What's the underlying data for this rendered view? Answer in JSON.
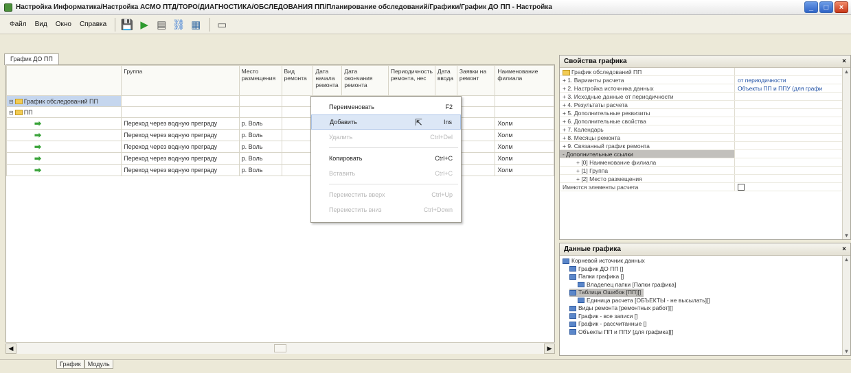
{
  "window": {
    "title": "Настройка Информатика/Настройка АСМО ПТД/ТОРО/ДИАГНОСТИКА/ОБСЛЕДОВАНИЯ ПП/Планирование обследований/Графики/График ДО ПП - Настройка"
  },
  "menu": [
    "Файл",
    "Вид",
    "Окно",
    "Справка"
  ],
  "toolbar_icons": [
    "save-icon",
    "run-icon",
    "properties-icon",
    "connections-icon",
    "table-icon",
    "window-icon"
  ],
  "doc_tab": "График ДО ПП",
  "grid": {
    "columns": [
      "",
      "Группа",
      "Место размещения",
      "Вид ремонта",
      "Дата начала ремонта",
      "Дата окончания ремонта",
      "Периодичность ремонта, нес",
      "Дата ввода",
      "Заявки на ремонт",
      "Наименование филиала"
    ],
    "root_label": "График обследований ПП",
    "group_label": "ПП",
    "rows": [
      {
        "group": "Переход через водную преграду",
        "place": "р. Воль",
        "last": "Холм"
      },
      {
        "group": "Переход через водную преграду",
        "place": "р. Воль",
        "last": "Холм"
      },
      {
        "group": "Переход через водную преграду",
        "place": "р. Воль",
        "last": "Холм"
      },
      {
        "group": "Переход через водную преграду",
        "place": "р. Воль",
        "last": "Холм"
      },
      {
        "group": "Переход через водную преграду",
        "place": "р. Воль",
        "last": "Холм"
      }
    ]
  },
  "context_menu": {
    "items": [
      {
        "label": "Переименовать",
        "shortcut": "F2",
        "enabled": true
      },
      {
        "label": "Добавить",
        "shortcut": "Ins",
        "enabled": true,
        "hover": true
      },
      {
        "label": "Удалить",
        "shortcut": "Ctrl+Del",
        "enabled": false
      },
      {
        "label": "Копировать",
        "shortcut": "Ctrl+C",
        "enabled": true
      },
      {
        "label": "Вставить",
        "shortcut": "Ctrl+C",
        "enabled": false
      },
      {
        "label": "Переместить вверх",
        "shortcut": "Ctrl+Up",
        "enabled": false
      },
      {
        "label": "Переместить вниз",
        "shortcut": "Ctrl+Down",
        "enabled": false
      }
    ]
  },
  "properties_panel": {
    "title": "Свойства графика",
    "root": "График обследований ПП",
    "rows": [
      {
        "name": "+ 1. Варианты расчета",
        "value": "от периодичности"
      },
      {
        "name": "+ 2. Настройка источника данных",
        "value": "Объекты ПП и ППУ (для графи"
      },
      {
        "name": "+ 3. Исходные данные от периодичности",
        "value": ""
      },
      {
        "name": "+ 4. Результаты расчета",
        "value": ""
      },
      {
        "name": "+ 5. Дополнительные реквизиты",
        "value": ""
      },
      {
        "name": "+ 6. Дополнительные свойства",
        "value": ""
      },
      {
        "name": "+ 7. Календарь",
        "value": ""
      },
      {
        "name": "+ 8. Месяцы ремонта",
        "value": ""
      },
      {
        "name": "+ 9. Связанный график ремонта",
        "value": ""
      },
      {
        "name": "- Дополнительные ссылки",
        "value": ""
      },
      {
        "name": "+ [0] Наименование филиала",
        "value": ""
      },
      {
        "name": "+ [1] Группа",
        "value": ""
      },
      {
        "name": "+ [2] Место размещения",
        "value": ""
      },
      {
        "name": "Имеются элементы расчета",
        "value": ""
      }
    ]
  },
  "data_panel": {
    "title": "Данные графика",
    "rows": [
      "Корневой источник данных",
      "График ДО ПП []",
      "Папки графика []",
      "Владелец папки [Папки графика]",
      "Таблица Ошибок [ПП][]",
      "Единица расчета [ОБЪЕКТЫ - не высылать][]",
      "Виды ремонта [ремонтных работ][]",
      "График - все записи []",
      "График - рассчитанные []",
      "Объекты ПП и ППУ [для графика][]"
    ]
  },
  "bottom_tabs": [
    "График",
    "Модуль"
  ]
}
